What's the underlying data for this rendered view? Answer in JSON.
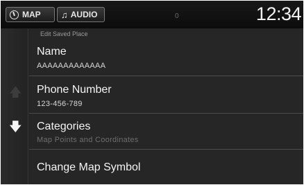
{
  "topbar": {
    "map_tab": "MAP",
    "audio_tab": "AUDIO",
    "signal": "0",
    "clock": "12:34"
  },
  "screen": {
    "subtitle": "Edit Saved Place"
  },
  "list": {
    "items": [
      {
        "label": "Name",
        "value": "AAAAAAAAAAAAA"
      },
      {
        "label": "Phone Number",
        "value": "123-456-789"
      },
      {
        "label": "Categories",
        "value": "Map Points and Coordinates"
      },
      {
        "label": "Change Map Symbol"
      }
    ]
  },
  "icons": {
    "map_tab_icon": "compass-icon",
    "audio_tab_icon": "music-note-icon",
    "scroll_up": "arrow-up-icon",
    "scroll_down": "arrow-down-icon"
  },
  "colors": {
    "background": "#262626",
    "text": "#f4f4f4",
    "disabled_text": "#6e6e6e"
  }
}
